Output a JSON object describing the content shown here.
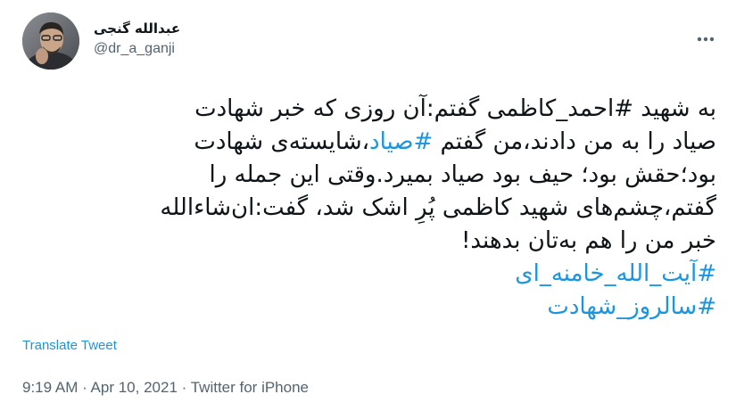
{
  "author": {
    "display_name": "عبدالله گنجی",
    "handle": "@dr_a_ganji"
  },
  "icons": {
    "avatar": "avatar-photo",
    "more": "more-options-icon"
  },
  "tweet": {
    "lines": [
      {
        "parts": [
          {
            "text": "به شهید ",
            "tag": false
          },
          {
            "text": "#احمد_کاظمی",
            "tag": false
          },
          {
            "text": " گفتم:آن روزی که خبر شهادت",
            "tag": false
          }
        ]
      },
      {
        "parts": [
          {
            "text": "صیاد را به من دادند،من گفتم ",
            "tag": false
          },
          {
            "text": "#صیاد",
            "tag": true
          },
          {
            "text": "،شایسته‌ی شهادت",
            "tag": false
          }
        ]
      },
      {
        "parts": [
          {
            "text": "بود؛حقش بود؛ حیف بود صیاد بمیرد.وقتی این جمله را",
            "tag": false
          }
        ]
      },
      {
        "parts": [
          {
            "text": "گفتم،چشم‌های شهید کاظمی پُرِ اشک شد، گفت:ان‌شاءالله",
            "tag": false
          }
        ]
      },
      {
        "parts": [
          {
            "text": "خبر من را هم به‌تان بدهند!",
            "tag": false
          }
        ]
      },
      {
        "parts": [
          {
            "text": "#آیت_الله_خامنه_ای",
            "tag": true
          }
        ]
      },
      {
        "parts": [
          {
            "text": "#سالروز_شهادت",
            "tag": true
          }
        ]
      }
    ],
    "translate_label": "Translate Tweet",
    "time": "9:19 AM",
    "separator": " · ",
    "date": "Apr 10, 2021",
    "source": "Twitter for iPhone"
  },
  "colors": {
    "hashtag": "#1b95e0",
    "secondary_text": "#536471",
    "primary_text": "#0f1419"
  }
}
